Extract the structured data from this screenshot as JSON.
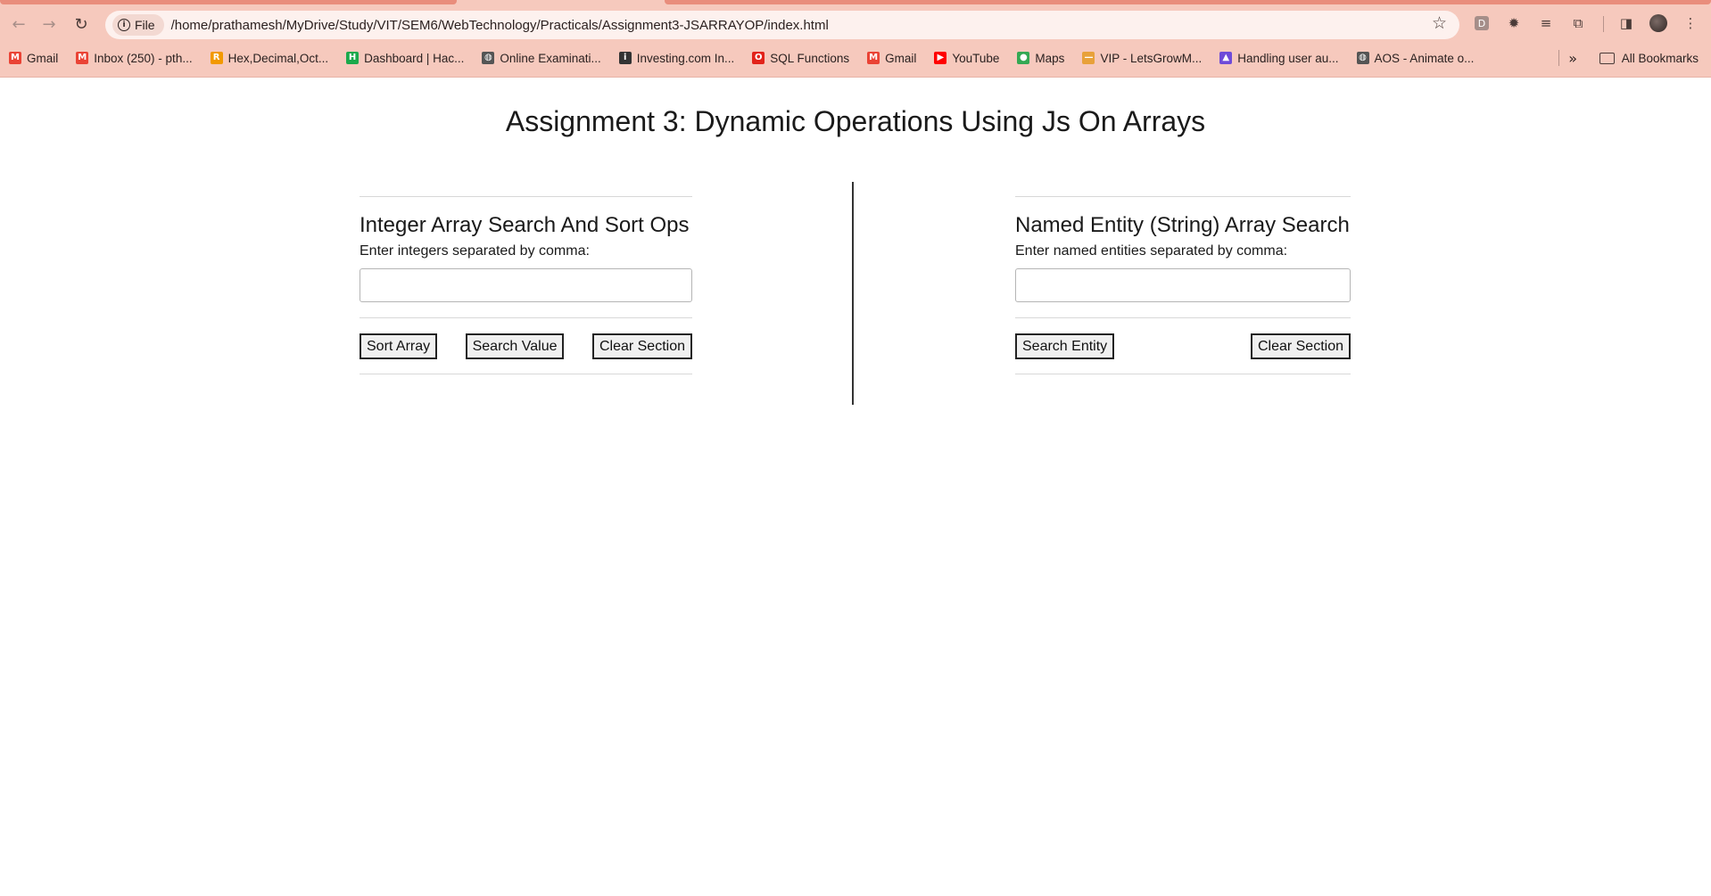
{
  "browser": {
    "site_chip": "File",
    "url": "/home/prathamesh/MyDrive/Study/VIT/SEM6/WebTechnology/Practicals/Assignment3-JSARRAYOP/index.html",
    "bookmarks": [
      {
        "label": "Gmail",
        "icon": "gmail-icon",
        "color": "#ea4335",
        "glyph": "M"
      },
      {
        "label": "Inbox (250) - pth...",
        "icon": "gmail-icon",
        "color": "#ea4335",
        "glyph": "M"
      },
      {
        "label": "Hex,Decimal,Oct...",
        "icon": "r-icon",
        "color": "#f29900",
        "glyph": "R"
      },
      {
        "label": "Dashboard | Hac...",
        "icon": "hackerrank-icon",
        "color": "#1ba94c",
        "glyph": "H"
      },
      {
        "label": "Online Examinati...",
        "icon": "globe-icon",
        "color": "#555555",
        "glyph": "◍"
      },
      {
        "label": "Investing.com In...",
        "icon": "investing-icon",
        "color": "#333333",
        "glyph": "i"
      },
      {
        "label": "SQL Functions",
        "icon": "oracle-icon",
        "color": "#e2231a",
        "glyph": "O"
      },
      {
        "label": "Gmail",
        "icon": "gmail-icon",
        "color": "#ea4335",
        "glyph": "M"
      },
      {
        "label": "YouTube",
        "icon": "youtube-icon",
        "color": "#ff0000",
        "glyph": "▶"
      },
      {
        "label": "Maps",
        "icon": "maps-icon",
        "color": "#34a853",
        "glyph": "●"
      },
      {
        "label": "VIP - LetsGrowM...",
        "icon": "dash-icon",
        "color": "#e8a13a",
        "glyph": "—"
      },
      {
        "label": "Handling user au...",
        "icon": "rocket-icon",
        "color": "#6f4bd8",
        "glyph": "▲"
      },
      {
        "label": "AOS - Animate o...",
        "icon": "globe-icon",
        "color": "#555555",
        "glyph": "◍"
      }
    ],
    "more_glyph": "»",
    "all_bookmarks": "All Bookmarks",
    "ext_d": "D"
  },
  "page": {
    "title": "Assignment 3: Dynamic Operations Using Js On Arrays",
    "integer_section": {
      "heading": "Integer Array Search And Sort Ops",
      "label": "Enter integers separated by comma:",
      "input_value": "",
      "sort_button": "Sort Array",
      "search_button": "Search Value",
      "clear_button": "Clear Section"
    },
    "string_section": {
      "heading": "Named Entity (String) Array Search",
      "label": "Enter named entities separated by comma:",
      "input_value": "",
      "search_button": "Search Entity",
      "clear_button": "Clear Section"
    }
  }
}
